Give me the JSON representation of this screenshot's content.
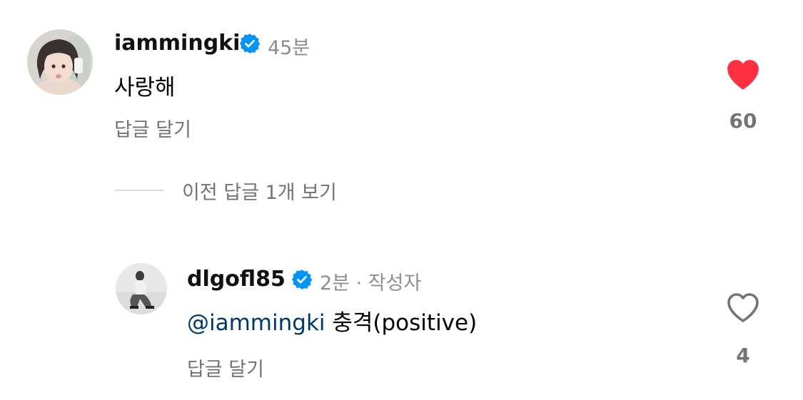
{
  "comments": [
    {
      "username": "iammingki",
      "time": "45분",
      "text": "사랑해",
      "reply_label": "답글 달기",
      "like_count": "60",
      "liked": true,
      "avatar_icon": "user-avatar-icon",
      "verified_icon": "verified-badge-icon"
    }
  ],
  "view_replies_label": "이전 답글 1개 보기",
  "replies": [
    {
      "username": "dlgofl85",
      "time": "2분 · 작성자",
      "mention": "@iammingki",
      "text": " 충격(positive)",
      "reply_label": "답글 달기",
      "like_count": "4",
      "liked": false,
      "avatar_icon": "user-avatar-icon",
      "verified_icon": "verified-badge-icon"
    }
  ],
  "colors": {
    "verified": "#0095f6",
    "liked_heart": "#ff3040",
    "mention": "#00376b",
    "muted_text": "#737373"
  }
}
